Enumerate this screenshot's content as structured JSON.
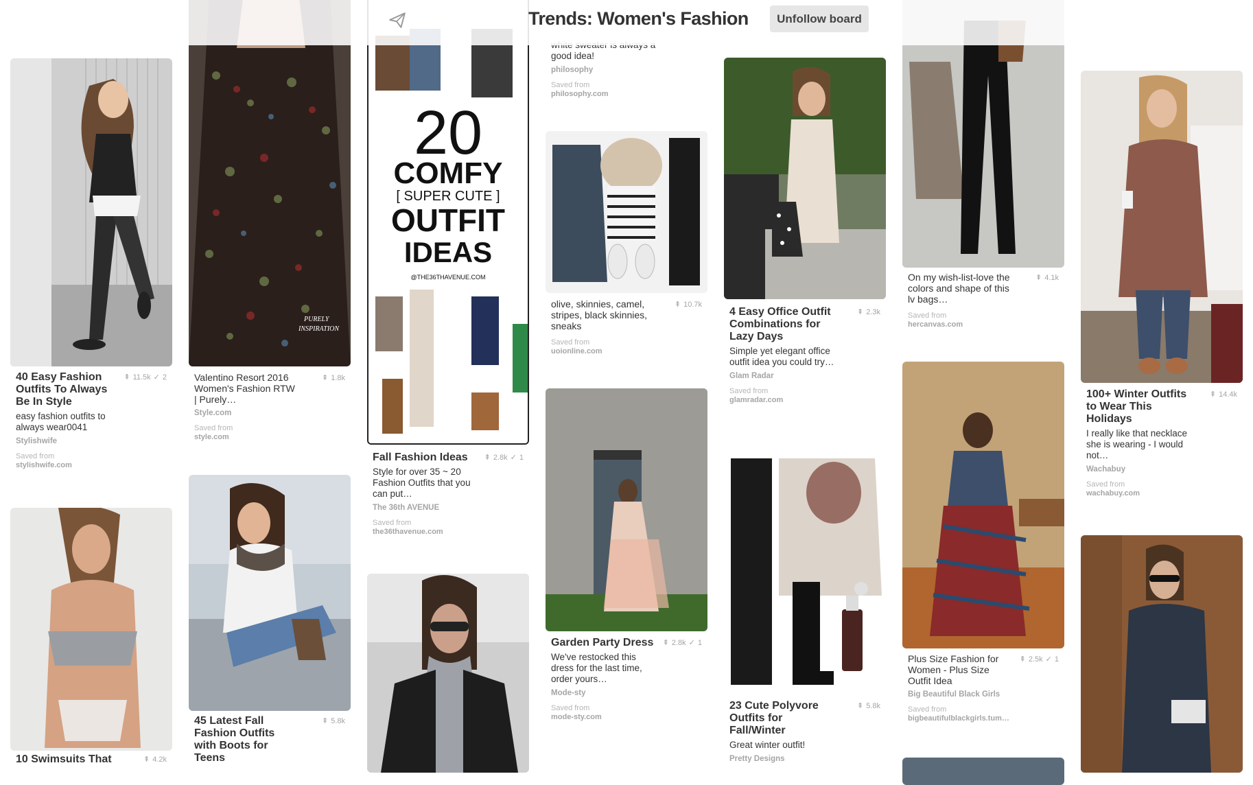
{
  "header": {
    "board_title": "Trends: Women's Fashion",
    "unfollow_label": "Unfollow board",
    "send_icon": "send-icon"
  },
  "colors": {
    "text": "#333333",
    "muted": "#a5a5a5",
    "button_bg": "#e6e6e6"
  },
  "pins": {
    "c1p1": {
      "title": "40 Easy Fashion Outfits To Always Be In Style",
      "repins": "11.5k",
      "likes": "2",
      "desc": "easy fashion outfits to always wear0041",
      "source": "Stylishwife",
      "saved": "Saved from",
      "url": "stylishwife.com"
    },
    "c1p2": {
      "title": "10 Swimsuits That",
      "repins": "4.2k"
    },
    "c2p1": {
      "title": "Valentino Resort 2016 Women's Fashion RTW | Purely…",
      "repins": "1.8k",
      "source": "Style.com",
      "saved": "Saved from",
      "url": "style.com",
      "img_text": "PURELY INSPIRATION"
    },
    "c2p2": {
      "title": "45 Latest Fall Fashion Outfits with Boots for Teens",
      "repins": "5.8k"
    },
    "c3p1": {
      "title": "Fall Fashion Ideas",
      "repins": "2.8k",
      "likes": "1",
      "desc": "Style for over 35 ~ 20 Fashion Outfits that you can put…",
      "source": "The 36th AVENUE",
      "saved": "Saved from",
      "url": "the36thavenue.com",
      "img_big": "20",
      "img_l1": "COMFY",
      "img_l2": "[ SUPER CUTE ]",
      "img_l3": "OUTFIT",
      "img_l4": "IDEAS",
      "img_credit": "@THE36THAVENUE.COM"
    },
    "c4p0": {
      "desc": "white sweater is always a good idea!",
      "source": "philosophy",
      "saved": "Saved from",
      "url": "philosophy.com"
    },
    "c4p1": {
      "title": "olive, skinnies, camel, stripes, black skinnies, sneaks",
      "repins": "10.7k",
      "saved": "Saved from",
      "url": "uoionline.com"
    },
    "c4p2": {
      "title": "Garden Party Dress",
      "repins": "2.8k",
      "likes": "1",
      "desc": "We've restocked this dress for the last time, order yours…",
      "source": "Mode-sty",
      "saved": "Saved from",
      "url": "mode-sty.com"
    },
    "c5p1": {
      "title": "4 Easy Office Outfit Combinations for Lazy Days",
      "repins": "2.3k",
      "desc": "Simple yet elegant office outfit idea you could try…",
      "source": "Glam Radar",
      "saved": "Saved from",
      "url": "glamradar.com"
    },
    "c5p2": {
      "title": "23 Cute Polyvore Outfits for Fall/Winter",
      "repins": "5.8k",
      "desc": "Great winter outfit!",
      "source": "Pretty Designs"
    },
    "c6p1": {
      "title": "On my wish-list-love the colors and shape of this lv bags…",
      "repins": "4.1k",
      "saved": "Saved from",
      "url": "hercanvas.com"
    },
    "c6p2": {
      "title": "Plus Size Fashion for Women - Plus Size Outfit Idea",
      "repins": "2.5k",
      "likes": "1",
      "source": "Big Beautiful Black Girls",
      "saved": "Saved from",
      "url": "bigbeautifulblackgirls.tum…"
    },
    "c7p1": {
      "title": "100+ Winter Outfits to Wear This Holidays",
      "repins": "14.4k",
      "desc": "I really like that necklace she is wearing - I would not…",
      "source": "Wachabuy",
      "saved": "Saved from",
      "url": "wachabuy.com"
    }
  }
}
